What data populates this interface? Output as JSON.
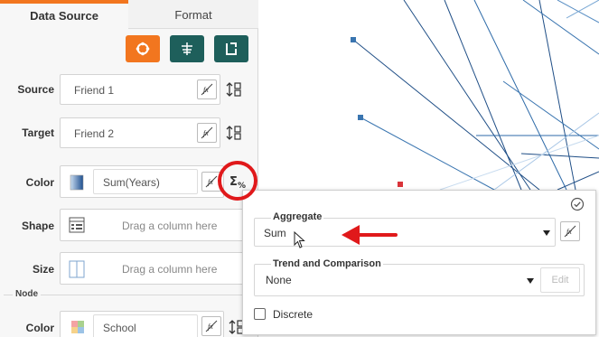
{
  "tabs": [
    {
      "label": "Data Source",
      "active": true
    },
    {
      "label": "Format",
      "active": false
    }
  ],
  "toolbar": {
    "buttons": [
      {
        "icon": "refresh-icon",
        "color": "#f2761f"
      },
      {
        "icon": "filter-icon",
        "color": "#1e5f5b"
      },
      {
        "icon": "export-icon",
        "color": "#1e5f5b"
      }
    ]
  },
  "fields": {
    "source": {
      "label": "Source",
      "value": "Friend 1"
    },
    "target": {
      "label": "Target",
      "value": "Friend 2"
    },
    "color": {
      "label": "Color",
      "value": "Sum(Years)"
    },
    "shape": {
      "label": "Shape",
      "placeholder": "Drag a column here"
    },
    "size": {
      "label": "Size",
      "placeholder": "Drag a column here"
    }
  },
  "node_section": {
    "title": "Node",
    "color": {
      "label": "Color",
      "value": "School"
    }
  },
  "popup": {
    "aggregate": {
      "title": "Aggregate",
      "value": "Sum"
    },
    "trend": {
      "title": "Trend and Comparison",
      "value": "None",
      "edit_label": "Edit"
    },
    "discrete": {
      "label": "Discrete",
      "checked": false
    }
  },
  "colors": {
    "accent_orange": "#f2761f",
    "teal": "#1e5f5b",
    "annotation_red": "#e0191b",
    "node_blue": "#3a75b0",
    "node_red": "#d9343a"
  }
}
